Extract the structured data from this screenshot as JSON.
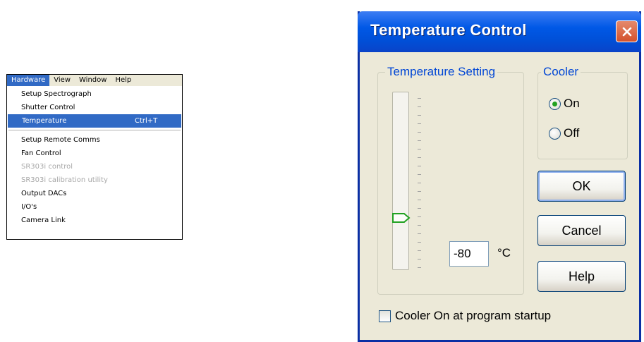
{
  "menu": {
    "bar": [
      "Hardware",
      "View",
      "Window",
      "Help"
    ],
    "active": "Hardware",
    "items": [
      {
        "label": "Setup Spectrograph"
      },
      {
        "label": "Shutter Control"
      },
      {
        "label": "Temperature",
        "shortcut": "Ctrl+T",
        "highlighted": true
      },
      {
        "label": "Setup Remote Comms"
      },
      {
        "label": "Fan Control"
      },
      {
        "label": "SR303i control",
        "disabled": true
      },
      {
        "label": "SR303i calibration utility",
        "disabled": true
      },
      {
        "label": "Output DACs"
      },
      {
        "label": "I/O's"
      },
      {
        "label": "Camera Link"
      }
    ]
  },
  "dialog": {
    "title": "Temperature Control",
    "temperature_group": {
      "label": "Temperature Setting",
      "value": "-80",
      "unit": "°C"
    },
    "cooler_group": {
      "label": "Cooler",
      "on_label": "On",
      "off_label": "Off",
      "selected": "On"
    },
    "buttons": {
      "ok": "OK",
      "cancel": "Cancel",
      "help": "Help"
    },
    "startup_checkbox": {
      "label": "Cooler On at program startup",
      "checked": false
    }
  },
  "colors": {
    "titlebar": "#0058e6",
    "menu_highlight": "#316ac5",
    "group_label": "#0046d5",
    "dialog_bg": "#ece9d8"
  }
}
